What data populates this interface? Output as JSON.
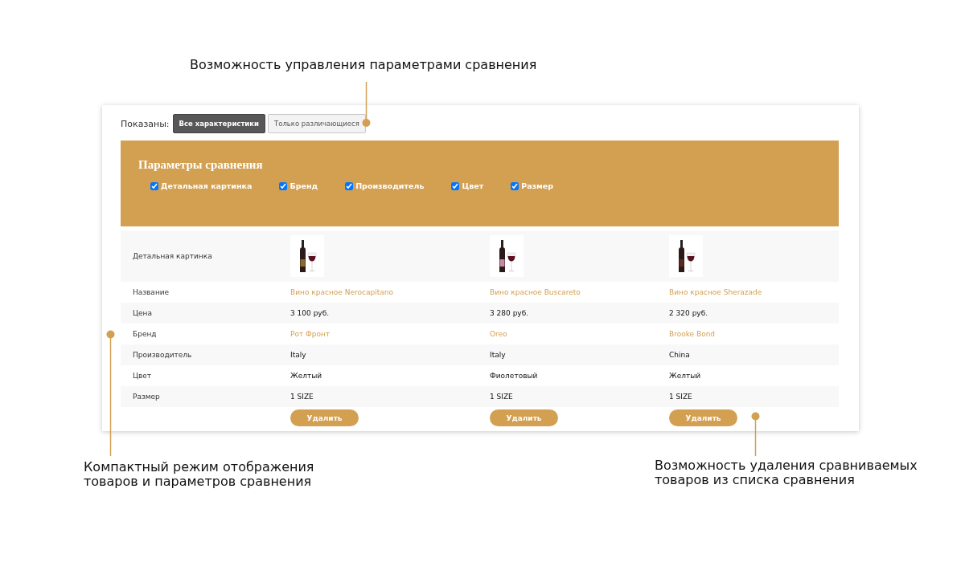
{
  "callouts": [
    {
      "text": "Возможность управления параметрами сравнения"
    },
    {
      "text": "Компактный режим отображения товаров и параметров сравнения"
    },
    {
      "text": "Возможность удаления сравниваемых товаров из списка сравнения"
    }
  ],
  "display_mode": {
    "label": "Показаны:",
    "buttons": [
      {
        "label": "Все характеристики",
        "selected": true
      },
      {
        "label": "Только различающиеся",
        "selected": false
      }
    ]
  },
  "params": {
    "title": "Параметры сравнения",
    "options": [
      {
        "label": "Детальная картинка",
        "checked": true
      },
      {
        "label": "Бренд",
        "checked": true
      },
      {
        "label": "Производитель",
        "checked": true
      },
      {
        "label": "Цвет",
        "checked": true
      },
      {
        "label": "Размер",
        "checked": true
      }
    ]
  },
  "table": {
    "rows": [
      {
        "label": "Детальная картинка",
        "kind": "image",
        "cells": [
          {},
          {},
          {}
        ]
      },
      {
        "label": "Название",
        "kind": "link",
        "cells": [
          {
            "text": "Вино красное Nerocapitano"
          },
          {
            "text": "Вино красное Buscareto"
          },
          {
            "text": "Вино красное Sherazade"
          }
        ]
      },
      {
        "label": "Цена",
        "kind": "text",
        "cells": [
          {
            "text": "3 100 руб."
          },
          {
            "text": "3 280 руб."
          },
          {
            "text": "2 320 руб."
          }
        ]
      },
      {
        "label": "Бренд",
        "kind": "link",
        "cells": [
          {
            "text": "Рот Фронт"
          },
          {
            "text": "Oreo"
          },
          {
            "text": "Brooke Bond"
          }
        ]
      },
      {
        "label": "Производитель",
        "kind": "text",
        "cells": [
          {
            "text": "Italy"
          },
          {
            "text": "Italy"
          },
          {
            "text": "China"
          }
        ]
      },
      {
        "label": "Цвет",
        "kind": "text",
        "cells": [
          {
            "text": "Желтый"
          },
          {
            "text": "Фиолетовый"
          },
          {
            "text": "Желтый"
          }
        ]
      },
      {
        "label": "Размер",
        "kind": "text",
        "cells": [
          {
            "text": "1 SIZE"
          },
          {
            "text": "1 SIZE"
          },
          {
            "text": "1 SIZE"
          }
        ]
      }
    ],
    "delete_buttons": [
      "Удалить",
      "Удалить",
      "Удалить"
    ]
  }
}
